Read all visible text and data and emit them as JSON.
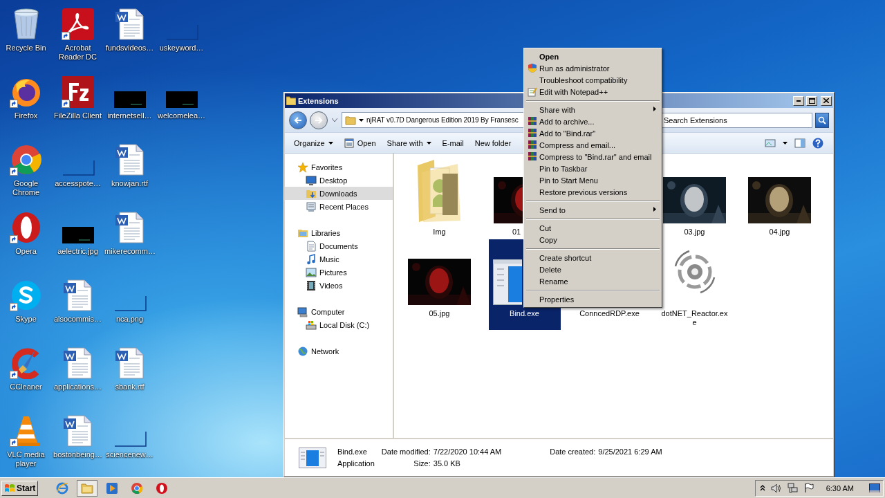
{
  "desktop": {
    "columns": [
      [
        {
          "label": "Recycle Bin",
          "kind": "recycle",
          "shortcut": false
        },
        {
          "label": "Firefox",
          "kind": "firefox",
          "shortcut": true
        },
        {
          "label": "Google Chrome",
          "kind": "chrome",
          "shortcut": true
        },
        {
          "label": "Opera",
          "kind": "opera",
          "shortcut": true
        },
        {
          "label": "Skype",
          "kind": "skype",
          "shortcut": true
        },
        {
          "label": "CCleaner",
          "kind": "ccleaner",
          "shortcut": true
        },
        {
          "label": "VLC media player",
          "kind": "vlc",
          "shortcut": true
        }
      ],
      [
        {
          "label": "Acrobat Reader DC",
          "kind": "acrobat",
          "shortcut": true
        },
        {
          "label": "FileZilla Client",
          "kind": "filezilla",
          "shortcut": true
        },
        {
          "label": "accesspote…",
          "kind": "blank",
          "shortcut": false
        },
        {
          "label": "aelectric.jpg",
          "kind": "black",
          "shortcut": false
        },
        {
          "label": "alsocommis…",
          "kind": "word",
          "shortcut": false
        },
        {
          "label": "applications…",
          "kind": "word",
          "shortcut": false
        },
        {
          "label": "bostonbeing…",
          "kind": "word",
          "shortcut": false
        }
      ],
      [
        {
          "label": "fundsvideos…",
          "kind": "word",
          "shortcut": false
        },
        {
          "label": "internetsell…",
          "kind": "black",
          "shortcut": false
        },
        {
          "label": "knowjan.rtf",
          "kind": "word",
          "shortcut": false
        },
        {
          "label": "mikerecomm…",
          "kind": "word",
          "shortcut": false
        },
        {
          "label": "nca.png",
          "kind": "blank",
          "shortcut": false
        },
        {
          "label": "sbank.rtf",
          "kind": "word",
          "shortcut": false
        },
        {
          "label": "sciencenew…",
          "kind": "blank",
          "shortcut": false
        }
      ],
      [
        {
          "label": "uskeyword…",
          "kind": "blank",
          "shortcut": false
        },
        {
          "label": "welcomelea…",
          "kind": "black",
          "shortcut": false
        }
      ]
    ]
  },
  "explorer": {
    "title": "Extensions",
    "path": "njRAT v0.7D Dangerous Edition 2019 By Fransesc",
    "search_placeholder": "Search Extensions",
    "toolbar": [
      {
        "label": "Organize",
        "kind": "menu"
      },
      {
        "label": "Open",
        "kind": "open"
      },
      {
        "label": "Share with",
        "kind": "menu"
      },
      {
        "label": "E-mail",
        "kind": "plain"
      },
      {
        "label": "New folder",
        "kind": "plain"
      }
    ],
    "sidebar": [
      {
        "label": "Favorites",
        "kind": "star",
        "selected": false,
        "children": [
          {
            "label": "Desktop",
            "kind": "desktop",
            "selected": false
          },
          {
            "label": "Downloads",
            "kind": "downloads",
            "selected": true
          },
          {
            "label": "Recent Places",
            "kind": "recent",
            "selected": false
          }
        ]
      },
      {
        "label": "Libraries",
        "kind": "libraries",
        "selected": false,
        "children": [
          {
            "label": "Documents",
            "kind": "documents",
            "selected": false
          },
          {
            "label": "Music",
            "kind": "music",
            "selected": false
          },
          {
            "label": "Pictures",
            "kind": "pictures",
            "selected": false
          },
          {
            "label": "Videos",
            "kind": "videos",
            "selected": false
          }
        ]
      },
      {
        "label": "Computer",
        "kind": "computer",
        "selected": false,
        "children": [
          {
            "label": "Local Disk (C:)",
            "kind": "disk",
            "selected": false
          }
        ]
      },
      {
        "label": "Network",
        "kind": "network",
        "selected": false
      }
    ],
    "files": [
      {
        "name": "Img",
        "kind": "folder",
        "selected": false
      },
      {
        "name": "01",
        "kind": "partial",
        "selected": false
      },
      {
        "kind": "covered"
      },
      {
        "name": "03.jpg",
        "selected": false
      },
      {
        "name": "04.jpg",
        "selected": false
      },
      {
        "name": "05.jpg",
        "selected": false
      },
      {
        "name": "Bind.exe",
        "kind": "app",
        "selected": true
      },
      {
        "name": "ConncedRDP.exe",
        "kind": "label-only",
        "selected": false
      },
      {
        "name": "dotNET_Reactor.exe",
        "kind": "reactor",
        "selected": false
      }
    ],
    "status": {
      "name": "Bind.exe",
      "type": "Application",
      "modified_label": "Date modified:",
      "modified": "7/22/2020 10:44 AM",
      "created_label": "Date created:",
      "created": "9/25/2021 6:29 AM",
      "size_label": "Size:",
      "size": "35.0 KB"
    }
  },
  "context_menu": [
    {
      "label": "Open",
      "kind": "default"
    },
    {
      "label": "Run as administrator",
      "kind": "shield"
    },
    {
      "label": "Troubleshoot compatibility",
      "kind": "item"
    },
    {
      "label": "Edit with Notepad++",
      "kind": "notepad"
    },
    {
      "kind": "separator"
    },
    {
      "label": "Share with",
      "kind": "submenu"
    },
    {
      "label": "Add to archive...",
      "kind": "archive"
    },
    {
      "label": "Add to \"Bind.rar\"",
      "kind": "archive"
    },
    {
      "label": "Compress and email...",
      "kind": "archive"
    },
    {
      "label": "Compress to \"Bind.rar\" and email",
      "kind": "archive"
    },
    {
      "label": "Pin to Taskbar",
      "kind": "item"
    },
    {
      "label": "Pin to Start Menu",
      "kind": "item"
    },
    {
      "label": "Restore previous versions",
      "kind": "item"
    },
    {
      "kind": "separator"
    },
    {
      "label": "Send to",
      "kind": "submenu"
    },
    {
      "kind": "separator"
    },
    {
      "label": "Cut",
      "kind": "item"
    },
    {
      "label": "Copy",
      "kind": "item"
    },
    {
      "kind": "separator"
    },
    {
      "label": "Create shortcut",
      "kind": "item"
    },
    {
      "label": "Delete",
      "kind": "item"
    },
    {
      "label": "Rename",
      "kind": "item"
    },
    {
      "kind": "separator"
    },
    {
      "label": "Properties",
      "kind": "item"
    }
  ],
  "taskbar": {
    "start": "Start",
    "apps": [
      {
        "kind": "ie",
        "selected": false
      },
      {
        "kind": "explorer",
        "selected": true
      },
      {
        "kind": "media",
        "selected": false
      },
      {
        "kind": "chrome",
        "selected": false
      },
      {
        "kind": "opera",
        "selected": false
      }
    ],
    "clock": "6:30 AM"
  }
}
